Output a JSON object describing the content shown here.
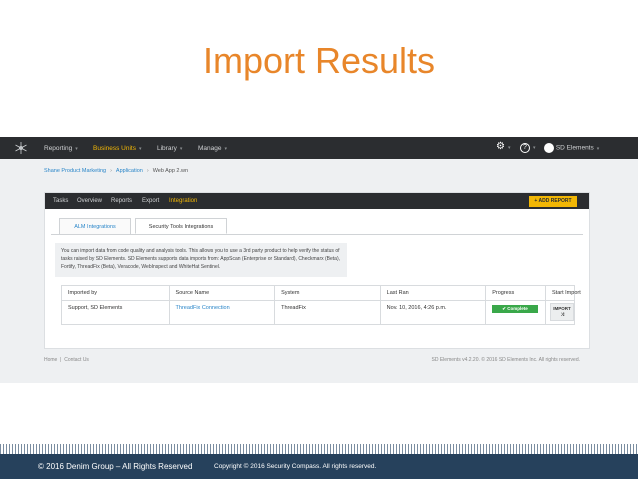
{
  "slide": {
    "title": "Import Results"
  },
  "topnav": {
    "items": [
      {
        "label": "Reporting"
      },
      {
        "label": "Business Units"
      },
      {
        "label": "Library"
      },
      {
        "label": "Manage"
      }
    ],
    "user_label": "SD Elements"
  },
  "breadcrumb": [
    "Shane Product Marketing",
    "Application",
    "Web App 2.wn"
  ],
  "card": {
    "tabs": [
      "Tasks",
      "Overview",
      "Reports",
      "Export",
      "Integration"
    ],
    "add_report_label": "+ ADD REPORT",
    "subtabs": [
      "ALM Integrations",
      "Security Tools Integrations"
    ],
    "info_text": "You can import data from code quality and analysis tools. This allows you to use a 3rd party product to help verify the status of tasks raised by SD Elements. SD Elements supports data imports from: AppScan (Enterprise or Standard), Checkmarx (Beta), Fortify, ThreadFix (Beta), Veracode, WebInspect and WhiteHat Sentinel.",
    "table": {
      "headers": [
        "Imported by",
        "Source Name",
        "System",
        "Last Ran",
        "Progress",
        "Start Import"
      ],
      "row": {
        "imported_by": "Support, SD Elements",
        "source_name": "ThreadFix Connection",
        "system": "ThreadFix",
        "last_ran": "Nov. 10, 2016, 4:26 p.m.",
        "progress": "✔ Complete",
        "start_import": "IMPORT"
      }
    }
  },
  "app_footer": {
    "home": "Home",
    "contact": "Contact Us",
    "copyright": "SD Elements v4.2.20. © 2016 SD Elements Inc. All rights reserved."
  },
  "slide_footer": {
    "left": "© 2016 Denim Group – All Rights Reserved",
    "right": "Copyright © 2016 Security Compass. All rights reserved."
  },
  "colors": {
    "title": "#e8862a",
    "nav_bg": "#2b2d30",
    "accent": "#f2b705",
    "link": "#2a86c9",
    "complete": "#3aa84a",
    "footer_bg": "#26415c"
  }
}
